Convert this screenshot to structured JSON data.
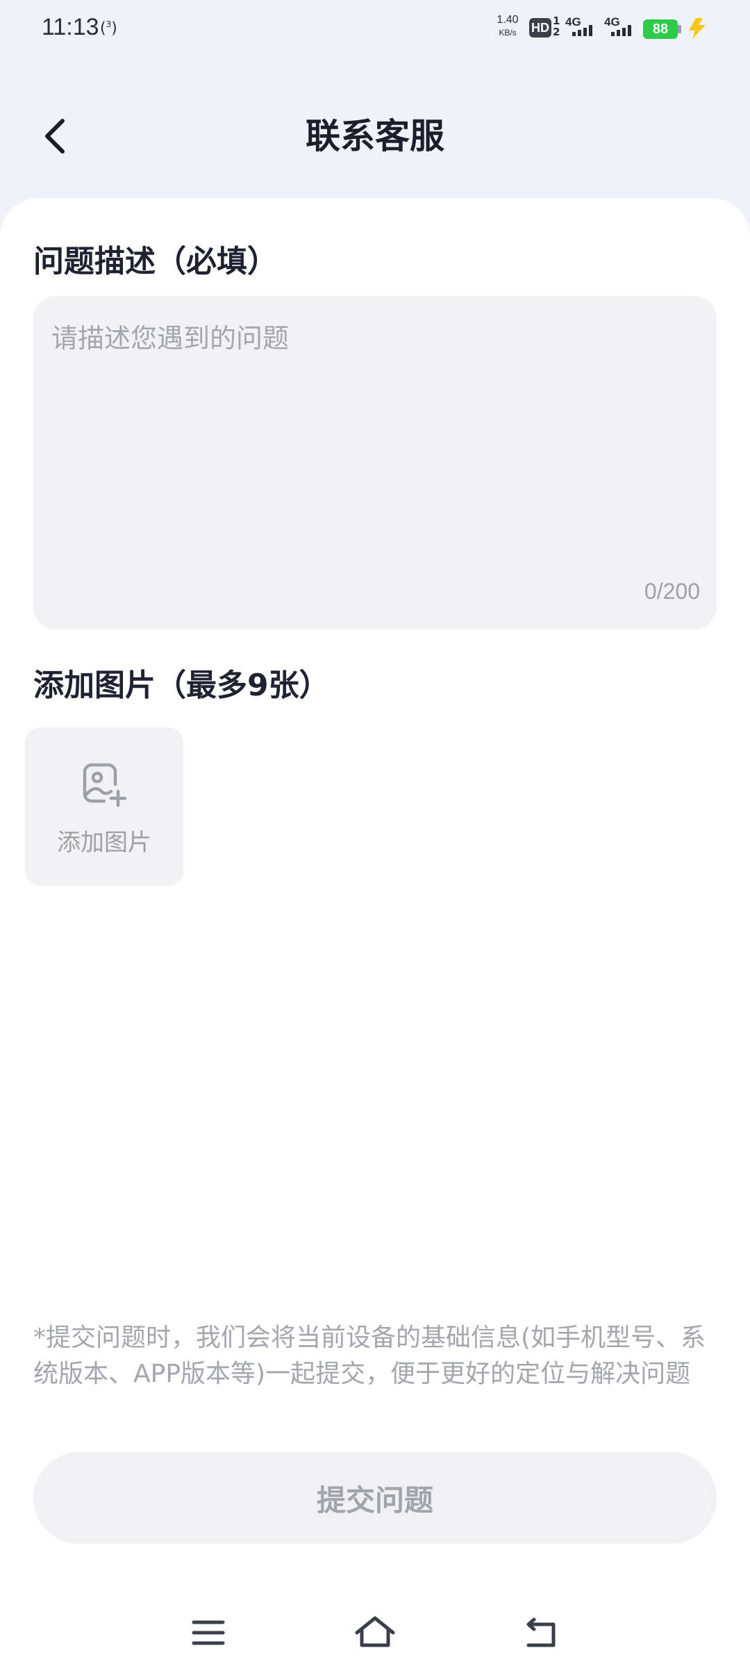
{
  "status_bar": {
    "time": "11:13",
    "hotspot_sup": "3",
    "net_speed_value": "1.40",
    "net_speed_unit": "KB/s",
    "hd_label": "HD",
    "hd_sub_top": "1",
    "hd_sub_bottom": "2",
    "signal1_label": "4G",
    "signal2_label": "4G",
    "battery_level": "88",
    "battery_color": "#2ecb4a",
    "charge_color": "#f5c518"
  },
  "header": {
    "back_icon": "chevron-left-icon",
    "title": "联系客服"
  },
  "form": {
    "description_title": "问题描述（必填）",
    "description_placeholder": "请描述您遇到的问题",
    "description_value": "",
    "char_count": "0/200",
    "images_title": "添加图片（最多9张）",
    "add_image_icon": "add-photo-icon",
    "add_image_label": "添加图片",
    "notice": "*提交问题时，我们会将当前设备的基础信息(如手机型号、系统版本、APP版本等)一起提交，便于更好的定位与解决问题",
    "submit_label": "提交问题"
  },
  "nav_bar": {
    "menu_icon": "menu-icon",
    "home_icon": "home-icon",
    "back_icon": "back-icon"
  }
}
